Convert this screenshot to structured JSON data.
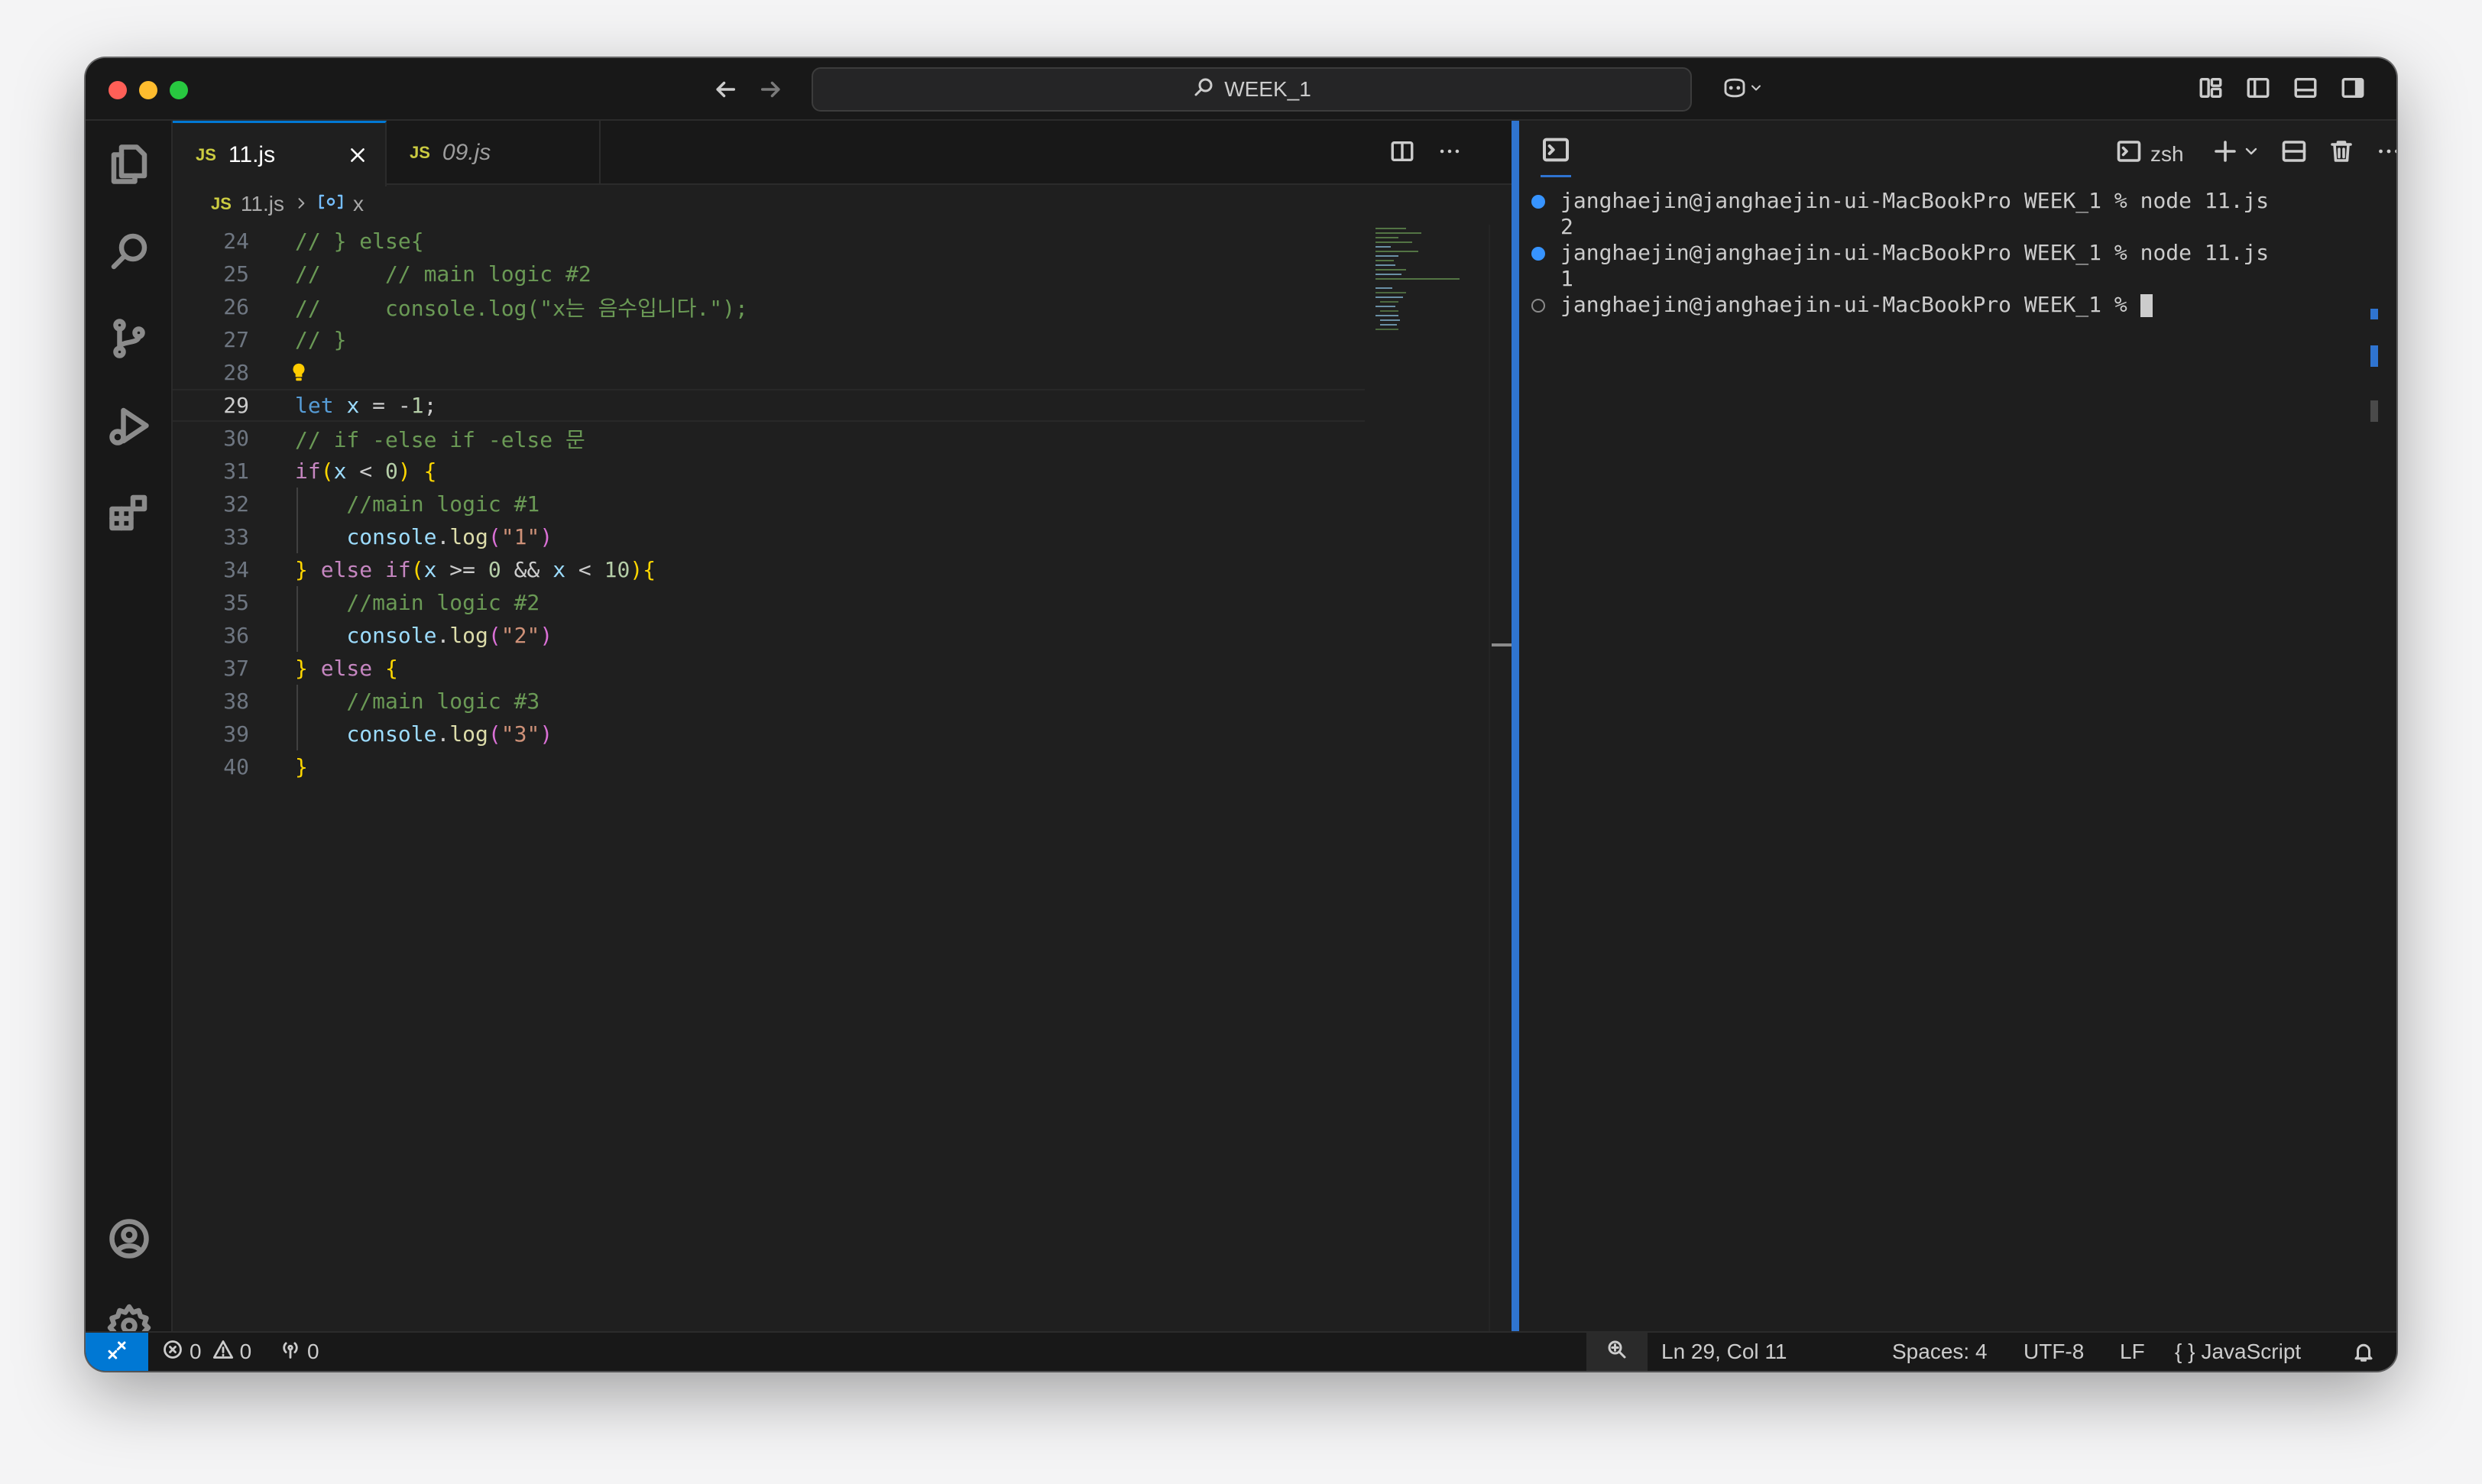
{
  "titlebar": {
    "search_label": "WEEK_1"
  },
  "tabs": [
    {
      "badge": "JS",
      "label": "11.js",
      "active": true
    },
    {
      "badge": "JS",
      "label": "09.js",
      "active": false
    }
  ],
  "breadcrumb": {
    "badge": "JS",
    "file": "11.js",
    "symbol": "x"
  },
  "editor": {
    "current_line": "29",
    "lines": [
      {
        "num": "24",
        "text": "// } else{"
      },
      {
        "num": "25",
        "text": "//     // main logic #2"
      },
      {
        "num": "26",
        "text": "//     console.log(\"x는 음수입니다.\");"
      },
      {
        "num": "27",
        "text": "// }"
      },
      {
        "num": "28",
        "text": ""
      },
      {
        "num": "29",
        "text": "let x = -1;"
      },
      {
        "num": "30",
        "text": "// if -else if -else 문"
      },
      {
        "num": "31",
        "text": "if(x < 0) {"
      },
      {
        "num": "32",
        "text": "    //main logic #1"
      },
      {
        "num": "33",
        "text": "    console.log(\"1\")"
      },
      {
        "num": "34",
        "text": "} else if(x >= 0 && x < 10){"
      },
      {
        "num": "35",
        "text": "    //main logic #2"
      },
      {
        "num": "36",
        "text": "    console.log(\"2\")"
      },
      {
        "num": "37",
        "text": "} else {"
      },
      {
        "num": "38",
        "text": "    //main logic #3"
      },
      {
        "num": "39",
        "text": "    console.log(\"3\")"
      },
      {
        "num": "40",
        "text": "}"
      }
    ]
  },
  "terminal": {
    "shell_label": "zsh",
    "lines": [
      {
        "text": "janghaejin@janghaejin-ui-MacBookPro WEEK_1 % node 11.js",
        "marker": "done"
      },
      {
        "text": "2",
        "marker": ""
      },
      {
        "text": "janghaejin@janghaejin-ui-MacBookPro WEEK_1 % node 11.js",
        "marker": "done"
      },
      {
        "text": "1",
        "marker": ""
      },
      {
        "text": "janghaejin@janghaejin-ui-MacBookPro WEEK_1 % ",
        "marker": "pending"
      }
    ]
  },
  "statusbar": {
    "errors": "0",
    "warnings": "0",
    "ports": "0",
    "position": "Ln 29, Col 11",
    "spaces": "Spaces: 4",
    "encoding": "UTF-8",
    "eol": "LF",
    "language_icon": "{ }",
    "language": "JavaScript"
  },
  "colors": {
    "accent": "#0078d4",
    "sash": "#2f74d0",
    "comment": "#6a9955",
    "keyword": "#569cd6",
    "control": "#c586c0",
    "string": "#ce9178",
    "number": "#b5cea8",
    "bracket": "#ffd700"
  }
}
